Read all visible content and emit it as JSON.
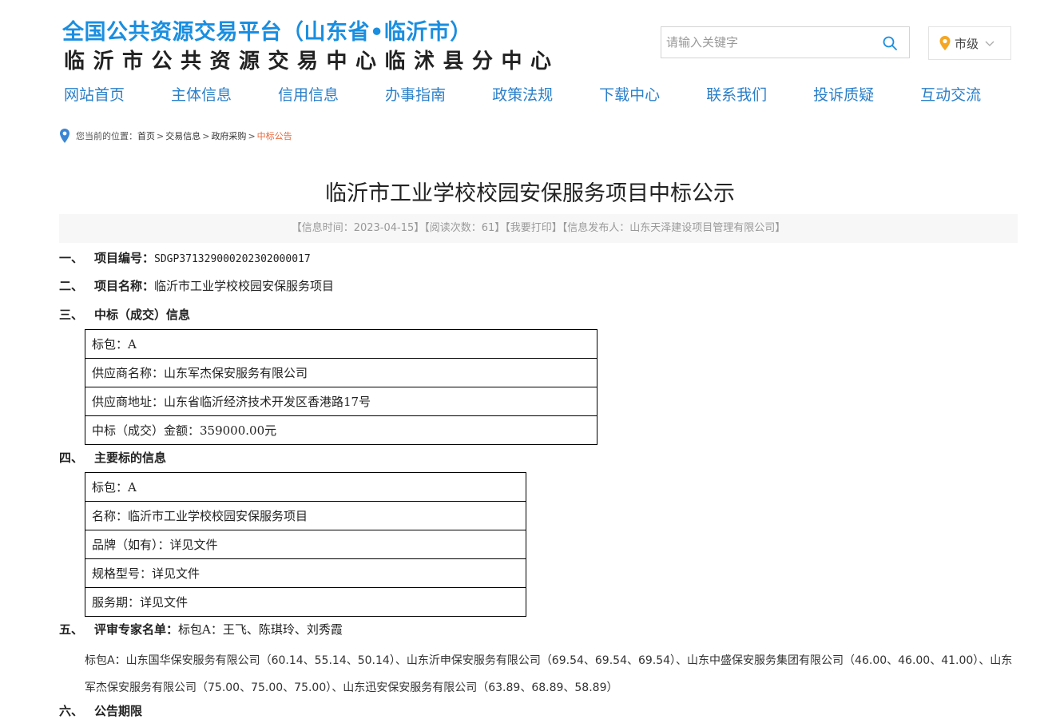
{
  "header": {
    "platform_title": "全国公共资源交易平台（山东省•临沂市）",
    "center_title": "临沂市公共资源交易中心临沭县分中心",
    "search_placeholder": "请输入关键字",
    "city_label": "市级"
  },
  "nav": [
    "网站首页",
    "主体信息",
    "信用信息",
    "办事指南",
    "政策法规",
    "下载中心",
    "联系我们",
    "投诉质疑",
    "互动交流"
  ],
  "breadcrumb": {
    "prefix": "您当前的位置：",
    "items": [
      "首页",
      "交易信息",
      "政府采购"
    ],
    "current": "中标公告"
  },
  "article": {
    "title": "临沂市工业学校校园安保服务项目中标公示",
    "meta": "【信息时间：2023-04-15】【阅读次数：61】【我要打印】【信息发布人：山东天泽建设项目管理有限公司】"
  },
  "sections": {
    "s1": {
      "num": "一、",
      "label": "项目编号：",
      "value": "SDGP371329000202302000017"
    },
    "s2": {
      "num": "二、",
      "label": "项目名称：",
      "value": "临沂市工业学校校园安保服务项目"
    },
    "s3": {
      "num": "三、",
      "label": "中标（成交）信息"
    },
    "s4": {
      "num": "四、",
      "label": "主要标的信息"
    },
    "s5": {
      "num": "五、",
      "label": "评审专家名单：",
      "value": "标包A：王飞、陈琪玲、刘秀霞"
    },
    "s6": {
      "num": "六、",
      "label": "公告期限"
    }
  },
  "award_table": [
    "标包：A",
    "供应商名称：山东军杰保安服务有限公司",
    "供应商地址：山东省临沂经济技术开发区香港路17号",
    "中标（成交）金额：359000.00元"
  ],
  "subject_table": [
    "标包：A",
    "名称：临沂市工业学校校园安保服务项目",
    "品牌（如有）：详见文件",
    "规格型号：详见文件",
    "服务期：详见文件"
  ],
  "rank_text": "标包A：山东国华保安服务有限公司（60.14、55.14、50.14）、山东沂申保安服务有限公司（69.54、69.54、69.54）、山东中盛保安服务集团有限公司（46.00、46.00、41.00）、山东军杰保安服务有限公司（75.00、75.00、75.00）、山东迅安保安服务有限公司（63.89、68.89、58.89）"
}
